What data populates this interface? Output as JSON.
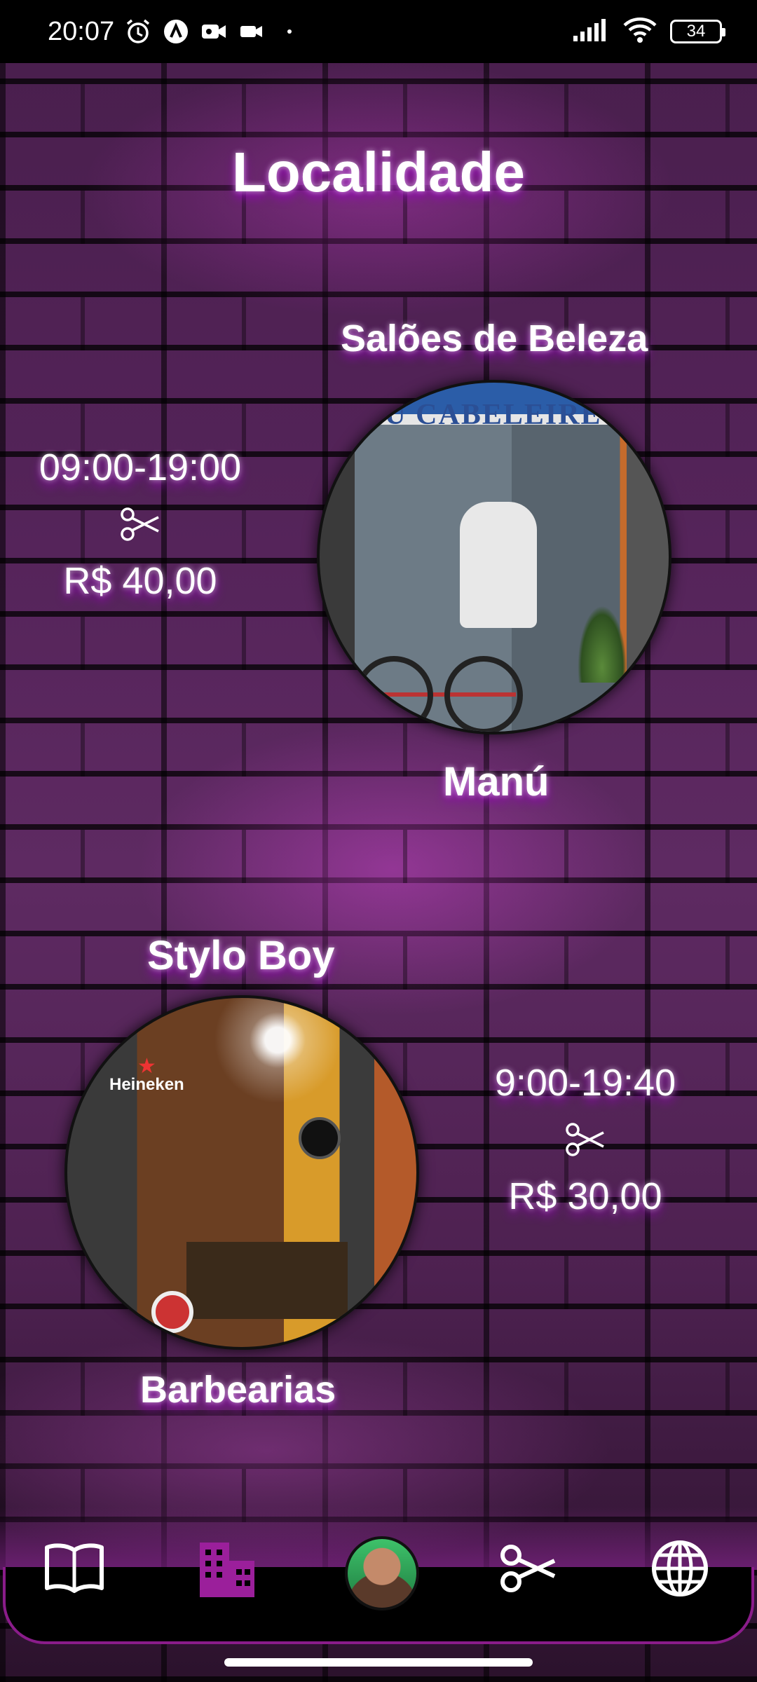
{
  "status_bar": {
    "time": "20:07",
    "battery": "34",
    "icons": [
      "alarm-icon",
      "app-icon",
      "video-icon",
      "camera-icon",
      "dot-icon",
      "signal-icon",
      "wifi-icon",
      "battery-icon"
    ]
  },
  "page": {
    "title": "Localidade"
  },
  "sections": {
    "salons_label": "Salões de Beleza",
    "barbershops_label": "Barbearias"
  },
  "shops": [
    {
      "name": "Manú",
      "hours": "09:00-19:00",
      "price": "R$ 40,00",
      "photo_sign": "NU CABELEIRE"
    },
    {
      "name": "Stylo Boy",
      "hours": "9:00-19:40",
      "price": "R$ 30,00",
      "photo_brand": "Heineken"
    }
  ],
  "bottom_nav": {
    "items": [
      "book-icon",
      "buildings-icon",
      "profile-avatar",
      "scissors-icon",
      "globe-icon"
    ],
    "active": "buildings-icon"
  },
  "colors": {
    "accent": "#9b1f9b",
    "glow": "#b000c8",
    "background": "#000000"
  }
}
